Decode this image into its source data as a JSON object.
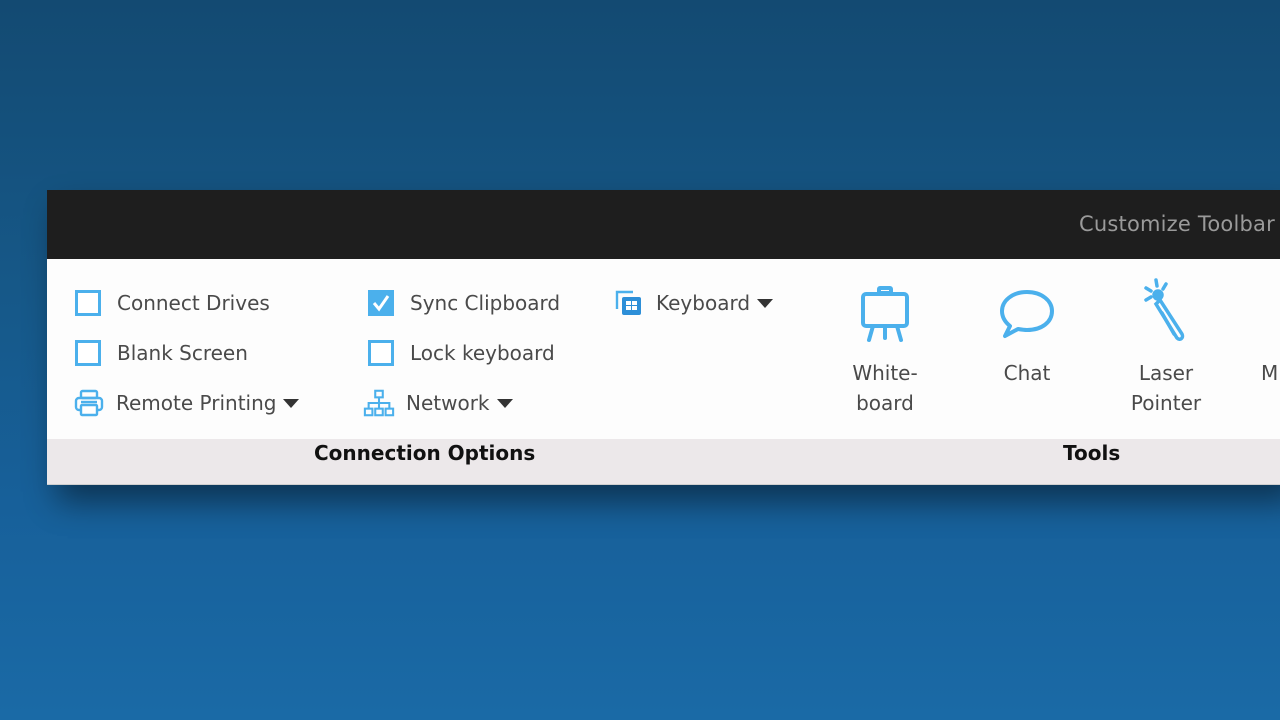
{
  "titlebar": {
    "customize_label": "Customize Toolbar"
  },
  "connection_options": {
    "group_label": "Connection Options",
    "checkboxes": [
      {
        "label": "Connect Drives",
        "checked": false
      },
      {
        "label": "Blank Screen",
        "checked": false
      },
      {
        "label": "Sync Clipboard",
        "checked": true
      },
      {
        "label": "Lock keyboard",
        "checked": false
      }
    ],
    "dropdowns": [
      {
        "label": "Remote Printing",
        "icon": "printer-icon"
      },
      {
        "label": "Network",
        "icon": "network-icon"
      },
      {
        "label": "Keyboard",
        "icon": "keyboard-windows-icon"
      }
    ]
  },
  "tools": {
    "group_label": "Tools",
    "items": [
      {
        "label_line1": "White-",
        "label_line2": "board",
        "icon": "whiteboard-icon"
      },
      {
        "label_line1": "Chat",
        "label_line2": "",
        "icon": "chat-icon"
      },
      {
        "label_line1": "Laser",
        "label_line2": "Pointer",
        "icon": "laser-pointer-icon"
      },
      {
        "label_line1": "M",
        "label_line2": "",
        "icon": ""
      }
    ]
  },
  "colors": {
    "accent": "#4bb0ec",
    "titlebar": "#1e1e1e",
    "desktop": "#165888"
  }
}
